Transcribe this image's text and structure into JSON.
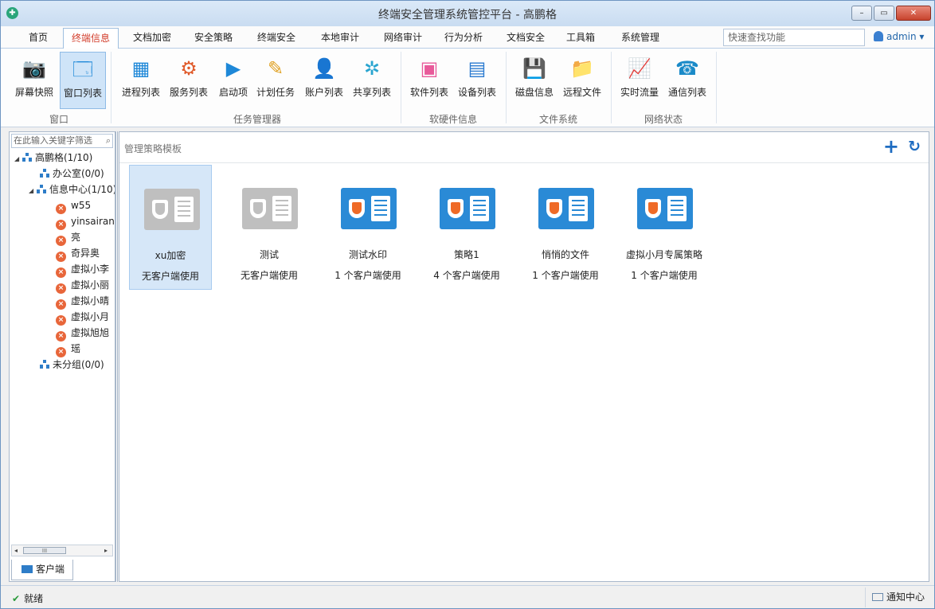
{
  "window": {
    "title": "终端安全管理系统管控平台 - 高鹏格",
    "minimize": "–",
    "maximize": "▭",
    "close": "✕"
  },
  "menu": {
    "tabs": [
      "首页",
      "终端信息",
      "文档加密",
      "安全策略",
      "终端安全",
      "本地审计",
      "网络审计",
      "行为分析",
      "文档安全",
      "工具箱",
      "系统管理"
    ],
    "active_index": 1,
    "search_placeholder": "快速查找功能",
    "user": "admin ▾"
  },
  "ribbon": {
    "groups": [
      {
        "label": "窗口",
        "buttons": [
          {
            "label": "屏幕快照",
            "icon": "camera-icon",
            "glyph": "📷"
          },
          {
            "label": "窗口列表",
            "icon": "window-list-icon",
            "glyph": "🗔",
            "active": true
          }
        ]
      },
      {
        "label": "任务管理器",
        "buttons": [
          {
            "label": "进程列表",
            "icon": "process-list-icon",
            "glyph": "▦"
          },
          {
            "label": "服务列表",
            "icon": "service-list-icon",
            "glyph": "⚙"
          },
          {
            "label": "启动项",
            "icon": "startup-icon",
            "glyph": "▶"
          },
          {
            "label": "计划任务",
            "icon": "scheduled-task-icon",
            "glyph": "✎"
          },
          {
            "label": "账户列表",
            "icon": "account-list-icon",
            "glyph": "👤"
          },
          {
            "label": "共享列表",
            "icon": "share-list-icon",
            "glyph": "✲"
          }
        ]
      },
      {
        "label": "软硬件信息",
        "buttons": [
          {
            "label": "软件列表",
            "icon": "software-list-icon",
            "glyph": "▣"
          },
          {
            "label": "设备列表",
            "icon": "device-list-icon",
            "glyph": "▤"
          }
        ]
      },
      {
        "label": "文件系统",
        "buttons": [
          {
            "label": "磁盘信息",
            "icon": "disk-info-icon",
            "glyph": "💾"
          },
          {
            "label": "远程文件",
            "icon": "remote-file-icon",
            "glyph": "📁"
          }
        ]
      },
      {
        "label": "网络状态",
        "buttons": [
          {
            "label": "实时流量",
            "icon": "realtime-traffic-icon",
            "glyph": "📈"
          },
          {
            "label": "通信列表",
            "icon": "phone-icon",
            "glyph": "☎"
          }
        ]
      }
    ]
  },
  "sidebar": {
    "search_placeholder": "在此输入关键字筛选",
    "tree": [
      {
        "label": "高鹏格(1/10)",
        "type": "org",
        "toggle": "◢",
        "level": 0
      },
      {
        "label": "办公室(0/0)",
        "type": "org",
        "level": 1
      },
      {
        "label": "信息中心(1/10)",
        "type": "org",
        "toggle": "◢",
        "level": 1
      },
      {
        "label": "w55",
        "type": "client",
        "level": 2
      },
      {
        "label": "yinsairan",
        "type": "client",
        "level": 2
      },
      {
        "label": "亮",
        "type": "client",
        "level": 2
      },
      {
        "label": "奇异奥",
        "type": "client",
        "level": 2
      },
      {
        "label": "虚拟小李",
        "type": "client",
        "level": 2
      },
      {
        "label": "虚拟小丽",
        "type": "client",
        "level": 2
      },
      {
        "label": "虚拟小晴",
        "type": "client",
        "level": 2
      },
      {
        "label": "虚拟小月",
        "type": "client",
        "level": 2
      },
      {
        "label": "虚拟旭旭",
        "type": "client",
        "level": 2
      },
      {
        "label": "瑶",
        "type": "client",
        "level": 2
      },
      {
        "label": "未分组(0/0)",
        "type": "org",
        "level": 1
      }
    ],
    "scroll_left": "◂",
    "scroll_right": "▸",
    "scroll_thumb": "III",
    "bottom_tab": "客户端"
  },
  "content": {
    "title": "管理策略模板",
    "add": "+",
    "refresh": "↻",
    "templates": [
      {
        "name": "xu加密",
        "status": "无客户端使用",
        "style": "grey",
        "selected": true
      },
      {
        "name": "测试",
        "status": "无客户端使用",
        "style": "grey"
      },
      {
        "name": "测试水印",
        "status": "1 个客户端使用",
        "style": "blue"
      },
      {
        "name": "策略1",
        "status": "4 个客户端使用",
        "style": "blue"
      },
      {
        "name": "悄悄的文件",
        "status": "1 个客户端使用",
        "style": "blue"
      },
      {
        "name": "虚拟小月专属策略",
        "status": "1 个客户端使用",
        "style": "blue"
      }
    ]
  },
  "status": {
    "ready": "就绪",
    "check": "✔",
    "notify": "通知中心"
  }
}
